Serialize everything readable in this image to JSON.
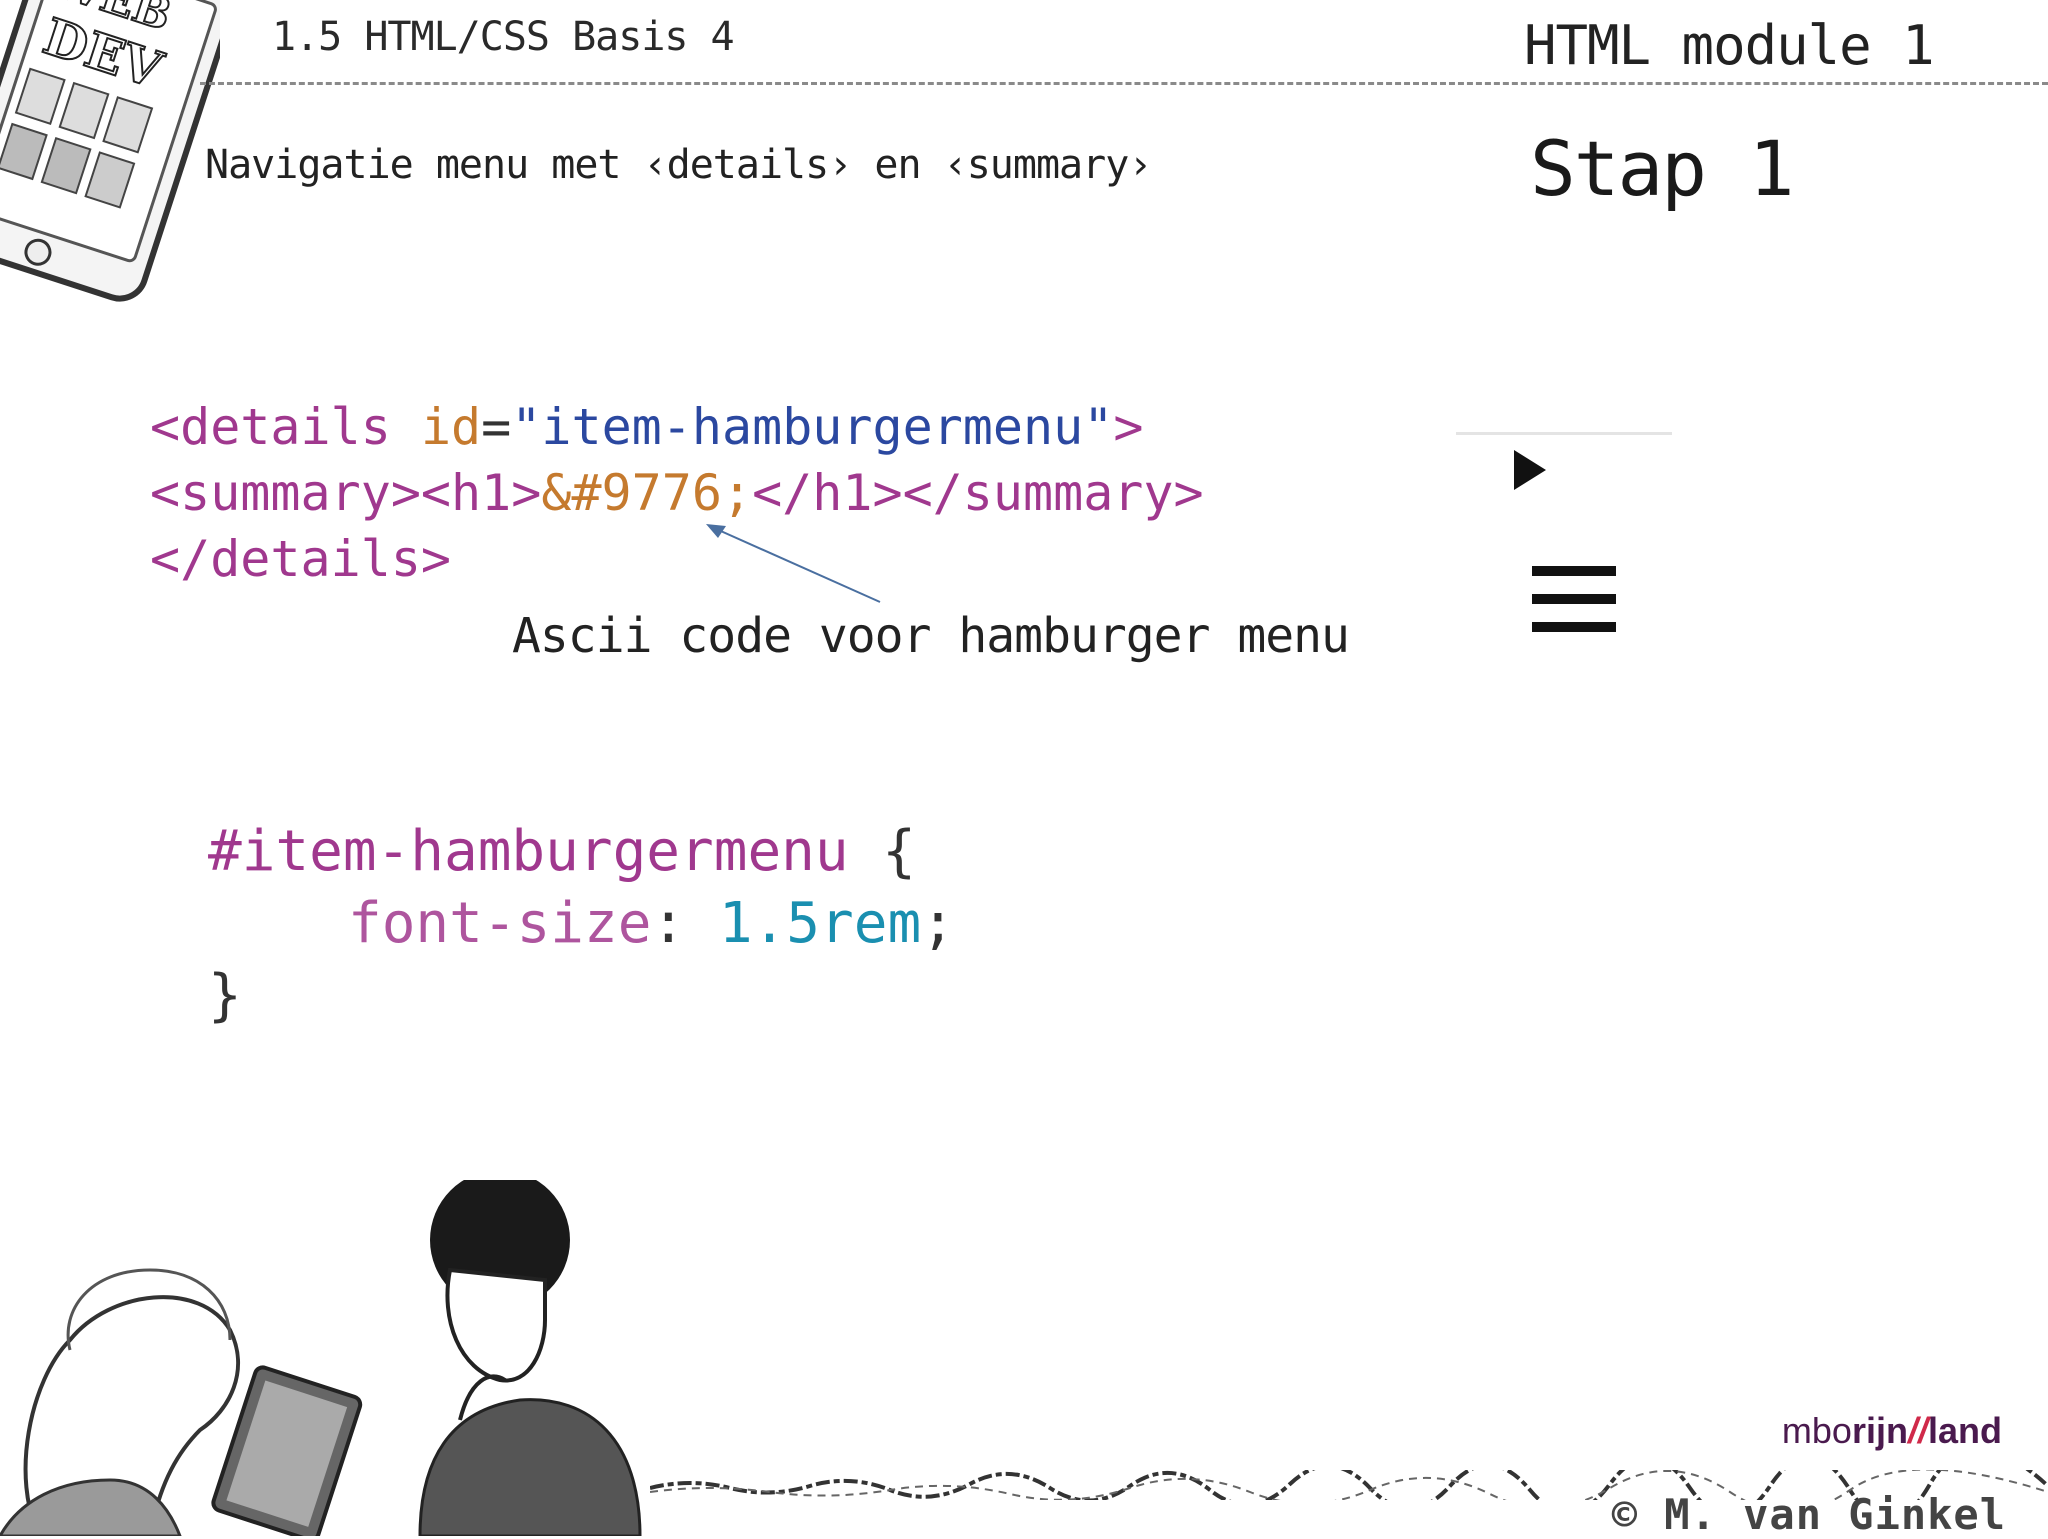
{
  "header": {
    "course": "1.5 HTML/CSS Basis 4",
    "module": "HTML module 1"
  },
  "subtitle": "Navigatie menu met ‹details› en ‹summary›",
  "step": "Stap 1",
  "html_code": {
    "line1_open": "<details ",
    "line1_attr": "id",
    "line1_eq": "=",
    "line1_str": "\"item-hamburgermenu\"",
    "line1_close": ">",
    "line2_open": "<summary><h1>",
    "line2_entity": "&#9776;",
    "line2_close": "</h1></summary>",
    "line3": "</details>"
  },
  "annotation": "Ascii code voor hamburger menu",
  "css_code": {
    "selector": "#item-hamburgermenu",
    "brace_open": " {",
    "property": "font-size",
    "colon": ": ",
    "value": "1.5rem",
    "semicolon": ";",
    "brace_close": "}"
  },
  "phone_badge": {
    "line1": "WEB",
    "line2": "DEV"
  },
  "footer": {
    "logo_a": "mbo",
    "logo_b": "rijn",
    "logo_sep": "//",
    "logo_c": "land",
    "copyright": "© M. van Ginkel"
  }
}
